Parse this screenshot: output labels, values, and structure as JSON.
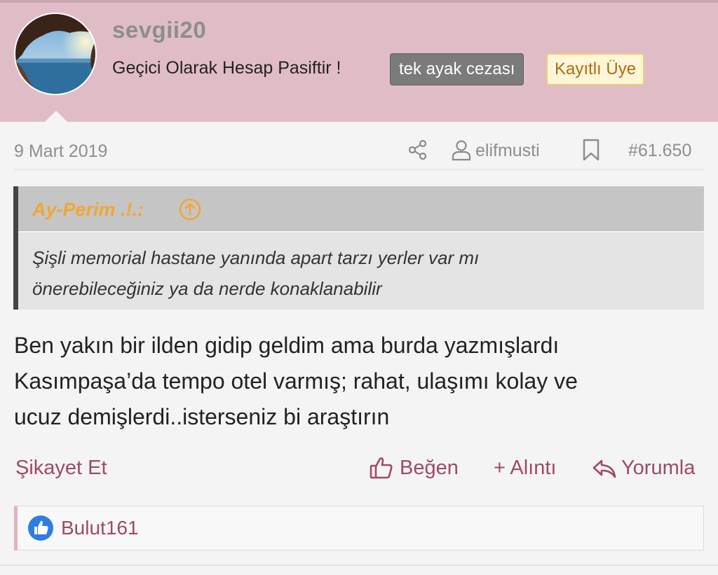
{
  "user": {
    "username": "sevgii20",
    "title": "Geçici Olarak Hesap Pasiftir !",
    "banner_badge": "tek ayak cezası",
    "member_badge": "Kayıtlı Üye"
  },
  "post_meta": {
    "date": "9 Mart 2019",
    "author": "elifmusti",
    "post_number": "#61.650",
    "icons": [
      "share-icon",
      "user-icon",
      "bookmark-icon"
    ]
  },
  "quote": {
    "author": "Ay-Perim .!.:",
    "line1": "Şişli memorial hastane yanında apart tarzı yerler var mı",
    "line2": "önerebileceğiniz ya da nerde konaklanabilir"
  },
  "body": {
    "line1": "Ben yakın bir ilden gidip geldim ama burda yazmışlardı",
    "line2": "Kasımpaşa’da tempo otel varmış; rahat, ulaşımı kolay ve",
    "line3": "ucuz demişlerdi..isterseniz bi araştırın"
  },
  "actions": {
    "report": "Şikayet Et",
    "like": "Beğen",
    "quote": "+ Alıntı",
    "reply": "Yorumla"
  },
  "reactions": {
    "liked_by": "Bulut161"
  },
  "colors": {
    "header_bg": "#e0bdc6",
    "accent": "#9f4a64",
    "quote_author": "#f0a733",
    "member_badge_text": "#b06a12",
    "like_blue": "#2f7de1"
  }
}
